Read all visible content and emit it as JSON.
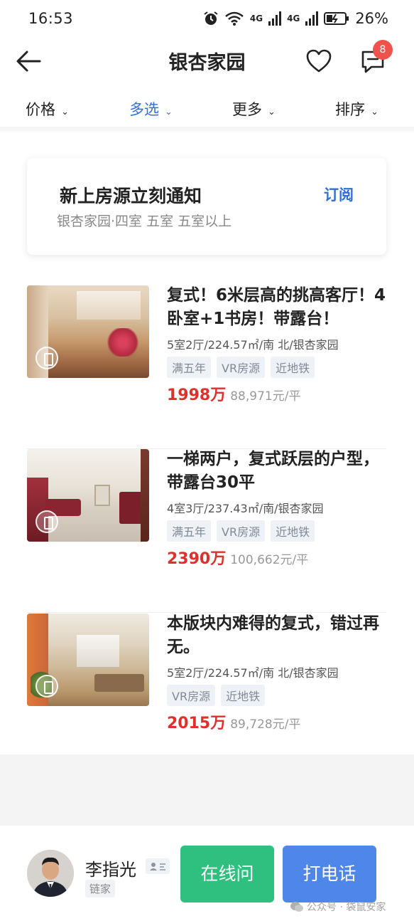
{
  "status_bar": {
    "time": "16:53",
    "network_a": "4G",
    "network_b": "4G",
    "battery": "26%",
    "icons": [
      "alarm-icon",
      "wifi-icon",
      "signal-icon",
      "signal-icon",
      "battery-icon"
    ]
  },
  "nav": {
    "title": "银杏家园",
    "message_badge": "8"
  },
  "filters": [
    {
      "label": "价格",
      "active": false
    },
    {
      "label": "多选",
      "active": true
    },
    {
      "label": "更多",
      "active": false
    },
    {
      "label": "排序",
      "active": false
    }
  ],
  "notify": {
    "title": "新上房源立刻通知",
    "subtitle": "银杏家园·四室 五室 五室以上",
    "action": "订阅"
  },
  "listings": [
    {
      "title": "复式！6米层高的挑高客厅！4卧室+1书房！带露台！",
      "meta": "5室2厅/224.57㎡/南 北/银杏家园",
      "tags": [
        "满五年",
        "VR房源",
        "近地铁"
      ],
      "price": "1998万",
      "unit_price": "88,971元/平"
    },
    {
      "title": "一梯两户，复式跃层的户型，带露台30平",
      "meta": "4室3厅/237.43㎡/南/银杏家园",
      "tags": [
        "满五年",
        "VR房源",
        "近地铁"
      ],
      "price": "2390万",
      "unit_price": "100,662元/平"
    },
    {
      "title": "本版块内难得的复式，错过再无。",
      "meta": "5室2厅/224.57㎡/南 北/银杏家园",
      "tags": [
        "VR房源",
        "近地铁"
      ],
      "price": "2015万",
      "unit_price": "89,728元/平"
    }
  ],
  "agent": {
    "name": "李指光",
    "agency": "链家",
    "chat_label": "在线问",
    "call_label": "打电话"
  },
  "watermark": "公众号 · 袋鼠安家",
  "colors": {
    "accent_blue": "#2f6fd6",
    "price_red": "#e0302b",
    "chat_green": "#2fbf7f",
    "call_blue": "#4f86ea",
    "badge_red": "#f0524c"
  }
}
